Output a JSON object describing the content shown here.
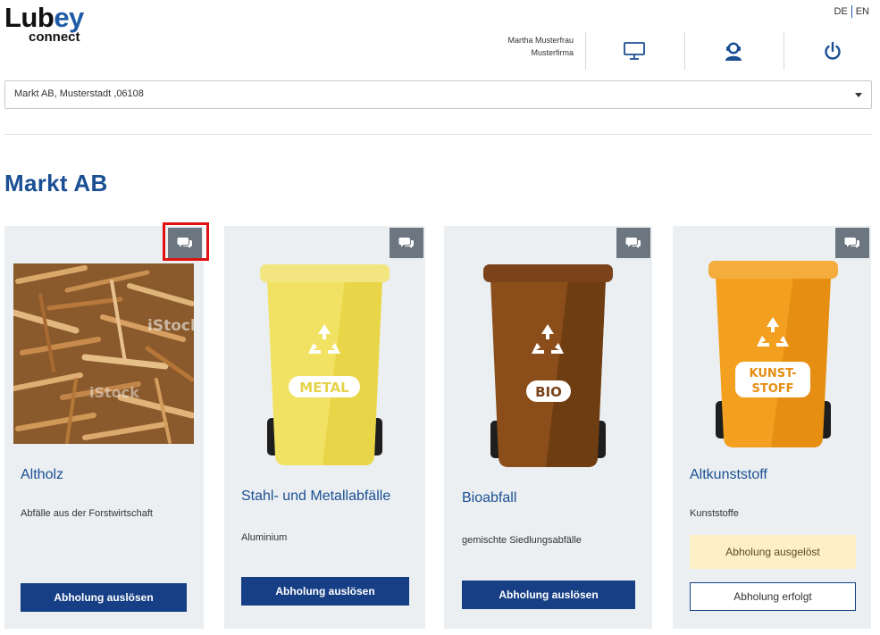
{
  "brand": {
    "logo_top_a": "Lub",
    "logo_top_b": "ey",
    "logo_bottom": "connect"
  },
  "language": {
    "de": "DE",
    "en": "EN"
  },
  "user": {
    "name": "Martha Musterfrau",
    "company": "Musterfirma"
  },
  "header_icons": [
    "monitor-icon",
    "support-agent-icon",
    "power-icon"
  ],
  "location_select": {
    "value": "Markt AB, Musterstadt ,06108"
  },
  "page": {
    "title": "Markt AB"
  },
  "colors": {
    "brand_blue": "#1a4f93",
    "button_blue": "#163f85",
    "card_bg": "#ebeff2",
    "chat_button": "#6c7680",
    "status_bg": "#fdf0c8"
  },
  "cards": [
    {
      "title": "Altholz",
      "subtitle": "Abfälle aus der Forstwirtschaft",
      "image": "wood-waste-photo",
      "watermark": "iStock",
      "action": "Abholung auslösen"
    },
    {
      "title": "Stahl- und Metallabfälle",
      "subtitle": "Aluminium",
      "image": "yellow-bin",
      "bin_label": "METAL",
      "action": "Abholung auslösen"
    },
    {
      "title": "Bioabfall",
      "subtitle": "gemischte Siedlungsabfälle",
      "image": "brown-bin",
      "bin_label": "BIO",
      "action": "Abholung auslösen"
    },
    {
      "title": "Altkunststoff",
      "subtitle": "Kunststoffe",
      "image": "orange-bin",
      "bin_label_1": "KUNST-",
      "bin_label_2": "STOFF",
      "status": "Abholung ausgelöst",
      "action": "Abholung erfolgt"
    }
  ]
}
